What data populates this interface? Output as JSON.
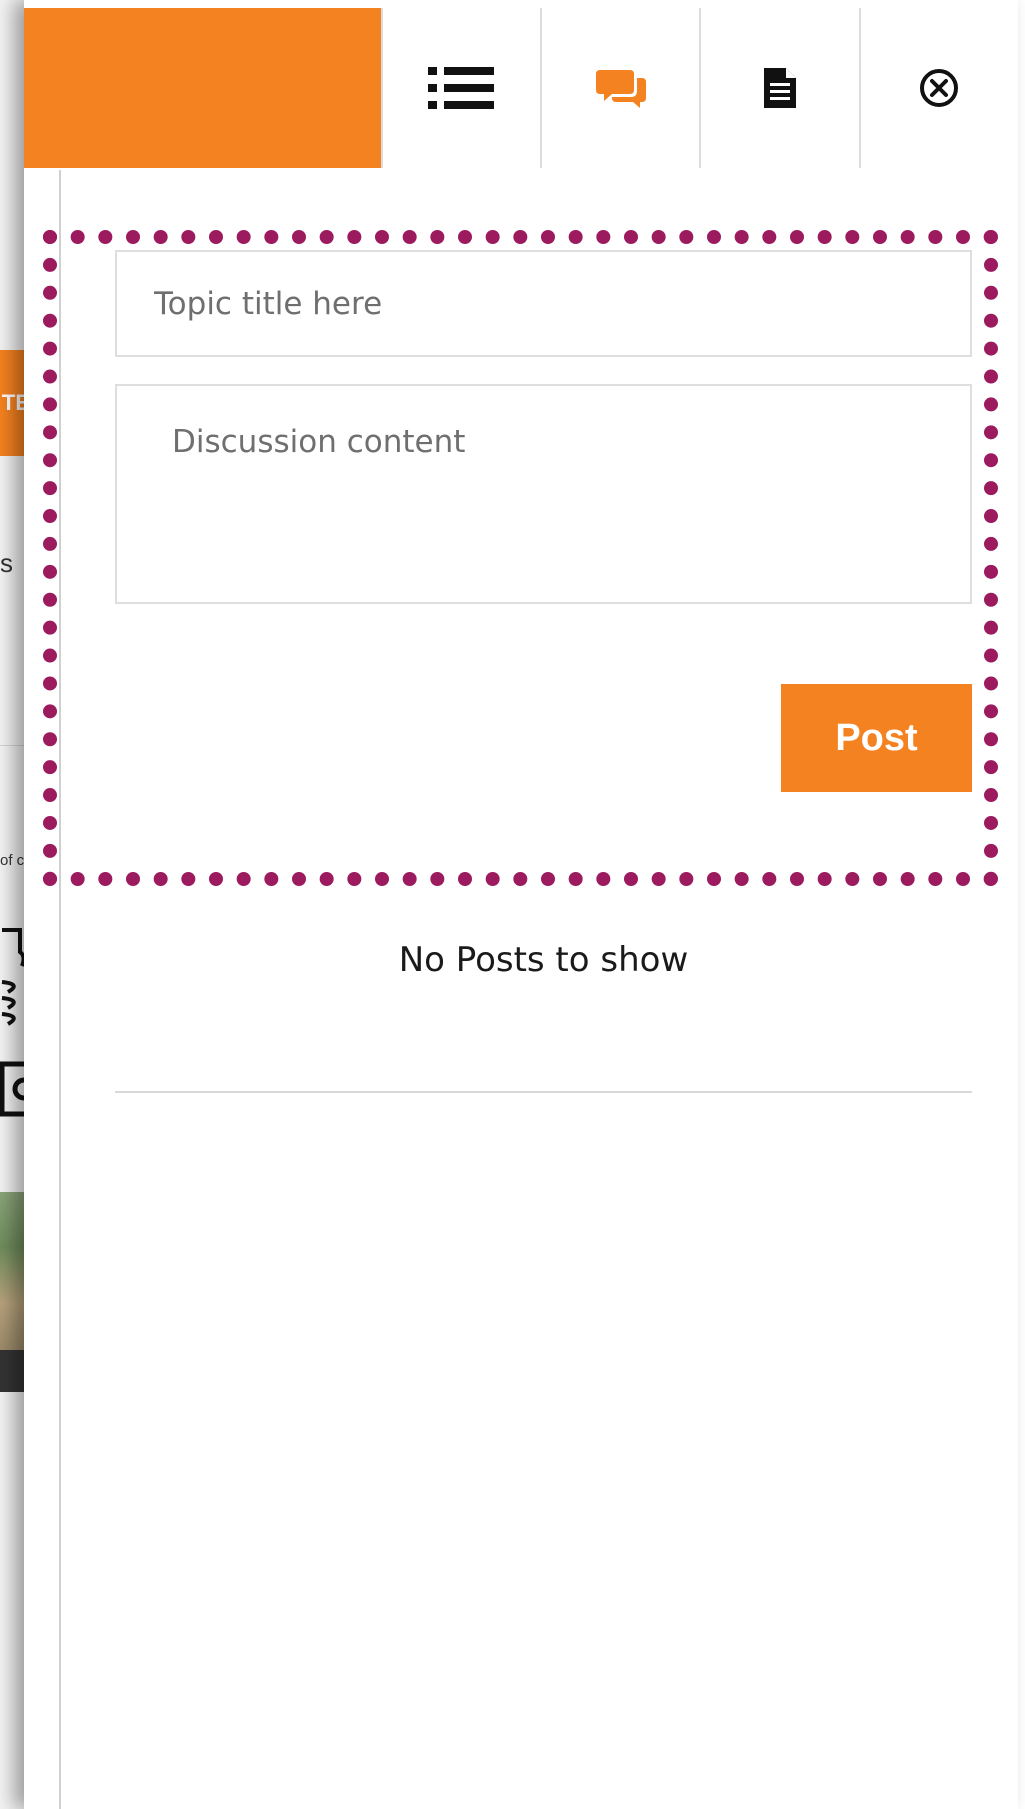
{
  "colors": {
    "brand": "#f58220",
    "highlight_border": "#9c1a5e",
    "divider": "#d9d9d9"
  },
  "background_page": {
    "orange_button_fragment": "TE",
    "text_fragment_1": "s",
    "text_fragment_2": "of c"
  },
  "toolbar": {
    "buttons": [
      {
        "icon": "list-icon",
        "active": false
      },
      {
        "icon": "comments-icon",
        "active": true
      },
      {
        "icon": "document-icon",
        "active": false
      },
      {
        "icon": "close-circle-icon",
        "active": false
      }
    ]
  },
  "form": {
    "title_placeholder": "Topic title here",
    "title_value": "",
    "content_placeholder": "Discussion content",
    "content_value": "",
    "post_label": "Post"
  },
  "posts": {
    "empty_message": "No Posts to show"
  }
}
